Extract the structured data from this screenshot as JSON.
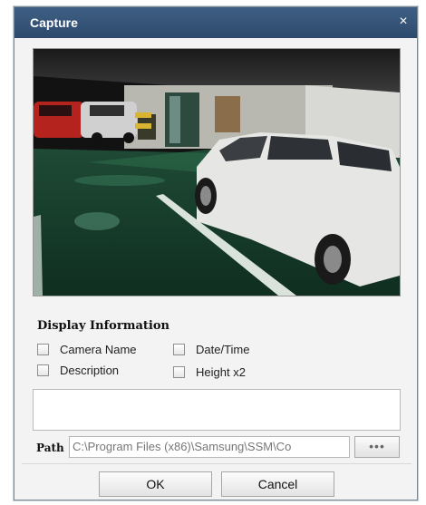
{
  "dialog": {
    "title": "Capture",
    "close_glyph": "×"
  },
  "preview": {
    "icon": "camera-snapshot-image"
  },
  "display_info": {
    "heading": "Display Information",
    "options": [
      {
        "label": "Camera Name",
        "checked": false
      },
      {
        "label": "Date/Time",
        "checked": false
      },
      {
        "label": "Description",
        "checked": false
      },
      {
        "label": "Height x2",
        "checked": false
      }
    ]
  },
  "description_text": "",
  "path": {
    "label": "Path",
    "value": "C:\\Program Files (x86)\\Samsung\\SSM\\Co",
    "browse_label": "•••"
  },
  "buttons": {
    "ok": "OK",
    "cancel": "Cancel"
  }
}
